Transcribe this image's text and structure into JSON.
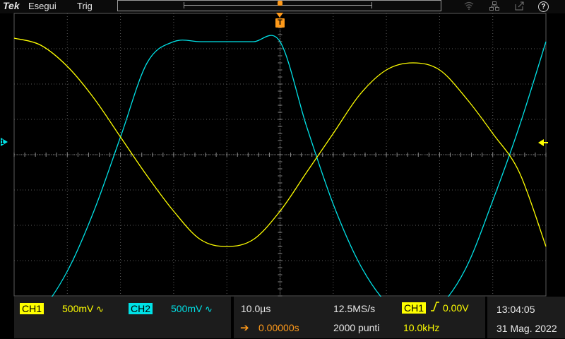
{
  "topbar": {
    "brand": "Tek",
    "menu_run": "Esegui",
    "menu_trig": "Trig",
    "help_glyph": "?"
  },
  "icons": [
    "wifi-icon",
    "network-icon",
    "export-icon",
    "help-icon",
    "sine-icon",
    "trigger-edge-icon",
    "arrow-right-icon"
  ],
  "colors": {
    "ch1": "#ffff00",
    "ch2": "#00e1e6",
    "trigger": "#ff9a1a",
    "grid": "#5a5a5a",
    "panel": "#1c1c1c"
  },
  "channels": {
    "ch1": {
      "label": "CH1",
      "scale": "500mV"
    },
    "ch2": {
      "label": "CH2",
      "scale": "500mV"
    },
    "ground_marker": "1"
  },
  "horizontal": {
    "time_per_div": "10.0µs",
    "position": "0.00000s",
    "sample_rate": "12.5MS/s",
    "record_length": "2000 punti"
  },
  "trigger": {
    "source": "CH1",
    "level": "0.00V",
    "frequency": "10.0kHz",
    "marker": "T"
  },
  "clock": {
    "time": "13:04:05",
    "date": "31 Mag. 2022"
  },
  "chart_data": {
    "type": "line",
    "xlabel": "",
    "ylabel": "",
    "x_units": "divisions",
    "y_units": "divisions",
    "xlim": [
      -5,
      5
    ],
    "ylim": [
      -4,
      4
    ],
    "grid": true,
    "series": [
      {
        "color": "#ffff00",
        "shape": "sine",
        "x": [
          -5.0,
          -4.5,
          -4.0,
          -3.5,
          -3.0,
          -2.5,
          -2.0,
          -1.5,
          -1.0,
          -0.5,
          0.0,
          0.5,
          1.0,
          1.5,
          2.0,
          2.5,
          3.0,
          3.5,
          4.0,
          4.5,
          5.0
        ],
        "y": [
          3.3,
          3.1,
          2.5,
          1.6,
          0.5,
          -0.6,
          -1.6,
          -2.4,
          -2.6,
          -2.4,
          -1.6,
          -0.5,
          0.6,
          1.7,
          2.4,
          2.6,
          2.4,
          1.6,
          0.6,
          -0.5,
          -2.6
        ]
      },
      {
        "color": "#00e1e6",
        "shape": "clipped-sine",
        "x": [
          -5.0,
          -4.5,
          -4.0,
          -3.5,
          -3.0,
          -2.5,
          -2.0,
          -1.5,
          -1.0,
          -0.5,
          0.0,
          0.5,
          1.0,
          1.5,
          2.0,
          2.5,
          3.0,
          3.5,
          4.0,
          4.5,
          5.0
        ],
        "y": [
          -4.7,
          -4.4,
          -3.3,
          -1.6,
          0.5,
          2.6,
          3.2,
          3.2,
          3.2,
          3.2,
          3.2,
          0.8,
          -1.4,
          -3.1,
          -4.2,
          -4.7,
          -4.3,
          -3.2,
          -1.3,
          0.8,
          3.2
        ]
      }
    ]
  }
}
